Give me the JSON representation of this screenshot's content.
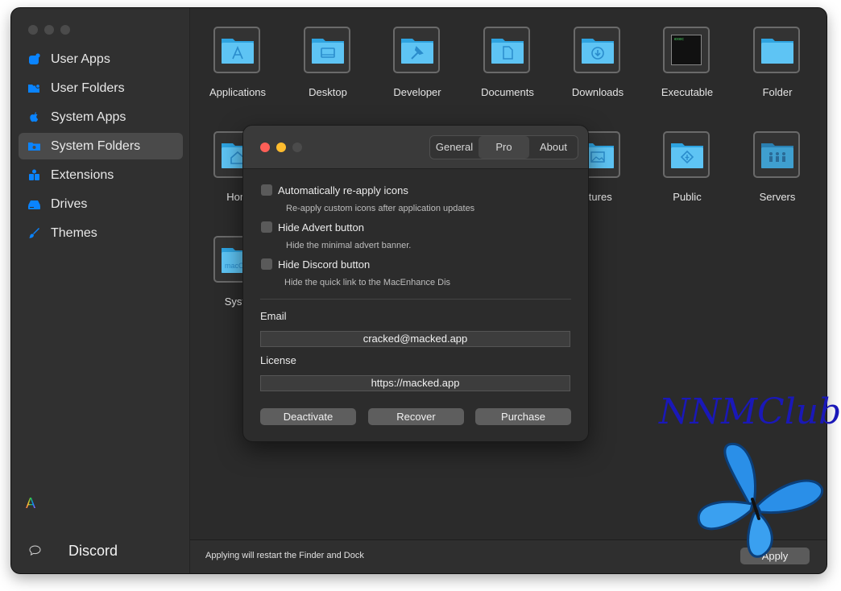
{
  "sidebar": {
    "items": [
      {
        "label": "User Apps",
        "icon": "user-apps-icon"
      },
      {
        "label": "User Folders",
        "icon": "user-folders-icon"
      },
      {
        "label": "System Apps",
        "icon": "apple-icon"
      },
      {
        "label": "System Folders",
        "icon": "system-folders-icon",
        "selected": true
      },
      {
        "label": "Extensions",
        "icon": "extensions-icon"
      },
      {
        "label": "Drives",
        "icon": "drive-icon"
      },
      {
        "label": "Themes",
        "icon": "themes-icon"
      }
    ],
    "app_glyph": "A",
    "discord_label": "Discord"
  },
  "grid": {
    "tiles": [
      {
        "name": "Applications",
        "icon": "applications-folder-icon"
      },
      {
        "name": "Desktop",
        "icon": "desktop-folder-icon"
      },
      {
        "name": "Developer",
        "icon": "developer-folder-icon"
      },
      {
        "name": "Documents",
        "icon": "documents-folder-icon"
      },
      {
        "name": "Downloads",
        "icon": "downloads-folder-icon"
      },
      {
        "name": "Executable",
        "icon": "executable-icon",
        "terminal_text": "exec"
      },
      {
        "name": "Folder",
        "icon": "generic-folder-icon"
      },
      {
        "name": "Hom",
        "icon": "home-folder-icon"
      },
      {
        "name": "ctures",
        "icon": "pictures-folder-icon"
      },
      {
        "name": "Public",
        "icon": "public-folder-icon"
      },
      {
        "name": "Servers",
        "icon": "servers-folder-icon"
      },
      {
        "name": "Syste",
        "icon": "system-folder-icon",
        "folder_text": "macO"
      }
    ]
  },
  "bottom": {
    "message": "Applying will restart the Finder and Dock",
    "apply_label": "Apply"
  },
  "prefs": {
    "tabs": [
      "General",
      "Pro",
      "About"
    ],
    "selected_tab": "Pro",
    "options": [
      {
        "label": "Automatically re-apply icons",
        "description": "Re-apply custom icons after application updates",
        "checked": false
      },
      {
        "label": "Hide Advert button",
        "description": "Hide the minimal advert banner.",
        "checked": false
      },
      {
        "label": "Hide Discord button",
        "description": "Hide the quick link to the MacEnhance Dis",
        "checked": false
      }
    ],
    "email_label": "Email",
    "email_value": "cracked@macked.app",
    "license_label": "License",
    "license_value": "https://macked.app",
    "buttons": {
      "deactivate": "Deactivate",
      "recover": "Recover",
      "purchase": "Purchase"
    }
  },
  "watermark": "NNMClub",
  "colors": {
    "accent": "#0a84ff",
    "folder_light": "#5ec4f4",
    "folder_dark": "#2ea3e0",
    "close": "#fe5f57",
    "minimize": "#febc2e",
    "butterfly": "#2a8fe8"
  }
}
